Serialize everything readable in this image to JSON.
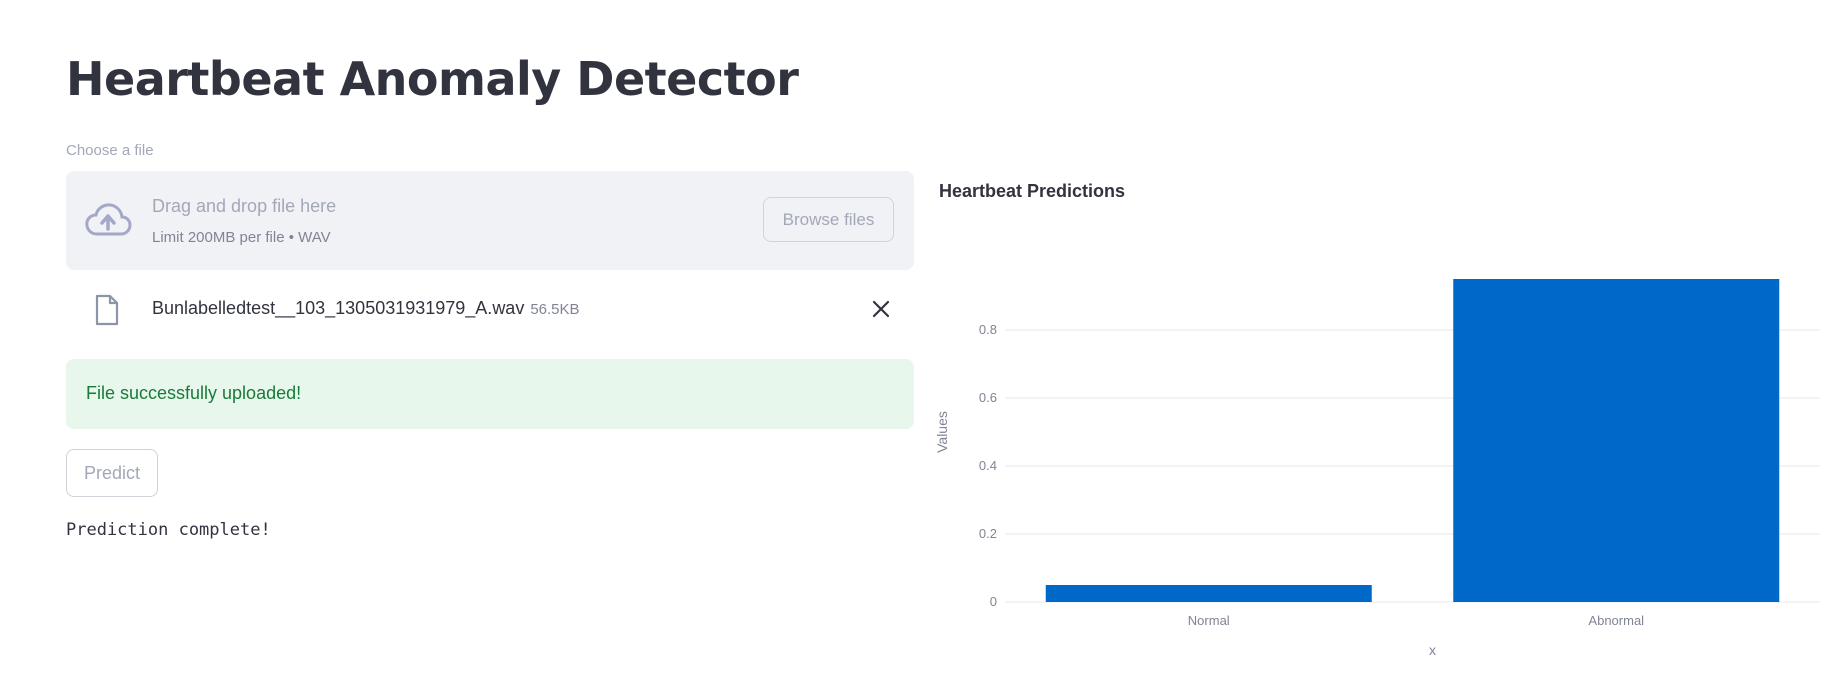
{
  "page": {
    "title": "Heartbeat Anomaly Detector"
  },
  "uploader": {
    "label": "Choose a file",
    "drop_text": "Drag and drop file here",
    "limit_text": "Limit 200MB per file • WAV",
    "browse_label": "Browse files",
    "icon": "cloud-upload-icon"
  },
  "uploaded_file": {
    "name": "Bunlabelledtest__103_1305031931979_A.wav",
    "size": "56.5KB",
    "icon": "file-icon",
    "remove_icon": "close-icon"
  },
  "alert": {
    "message": "File successfully uploaded!",
    "color": "#1a7a3a",
    "background": "#e8f7ec"
  },
  "actions": {
    "predict_label": "Predict"
  },
  "status": {
    "text": "Prediction complete!"
  },
  "chart_data": {
    "type": "bar",
    "title": "Heartbeat Predictions",
    "xlabel": "x",
    "ylabel": "Values",
    "categories": [
      "Normal",
      "Abnormal"
    ],
    "values": [
      0.05,
      0.95
    ],
    "ylim": [
      0,
      1
    ],
    "yticks": [
      0,
      0.2,
      0.4,
      0.6,
      0.8
    ],
    "ytick_labels": [
      "0",
      "0.2",
      "0.4",
      "0.6",
      "0.8"
    ],
    "grid": true,
    "bar_color": "#0068c9"
  }
}
